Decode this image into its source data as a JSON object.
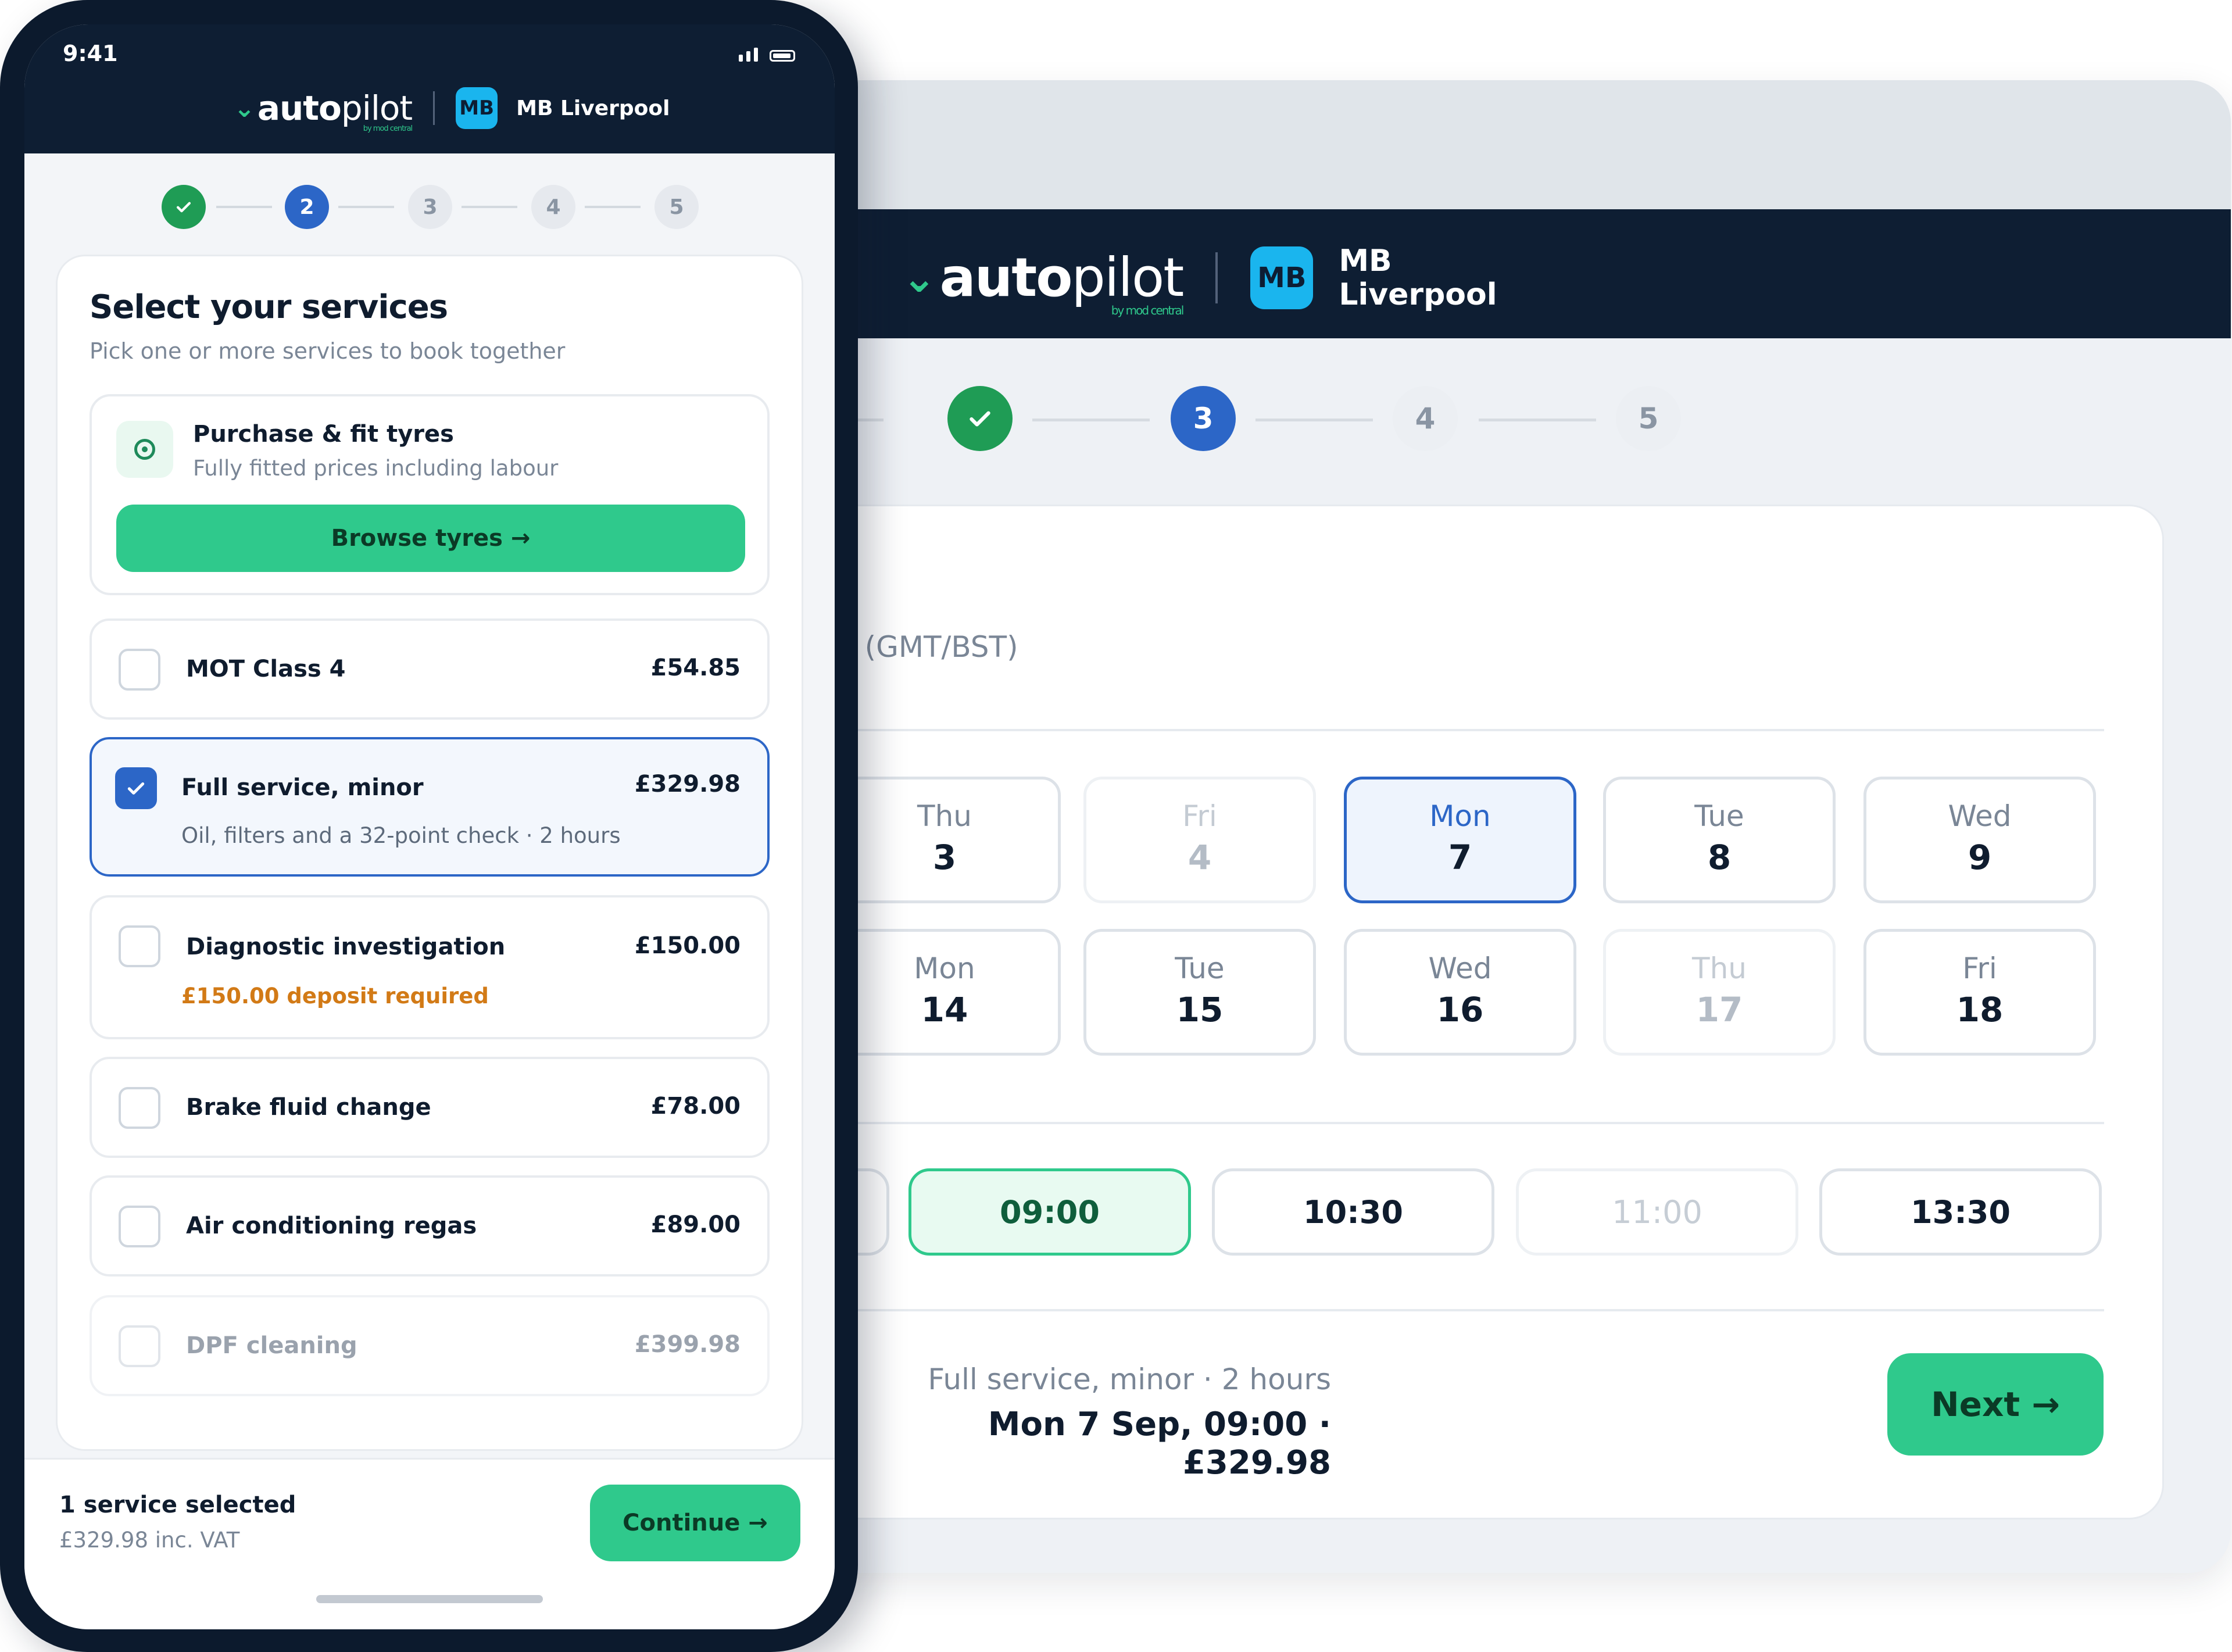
{
  "brand": {
    "logo_bold": "auto",
    "logo_light": "pilot",
    "logo_sub": "by mod central",
    "garage_badge": "MB",
    "garage_name": "MB Liverpool",
    "garage_line1": "MB",
    "garage_line2": "Liverpool"
  },
  "colors": {
    "navy": "#0e1e33",
    "accent_green": "#2fc98c",
    "accent_blue": "#2c66c7",
    "badge_cyan": "#1ab5ee",
    "deposit_orange": "#d27a16"
  },
  "desktop": {
    "steps": [
      {
        "label": "",
        "state": "done",
        "icon": "check-icon"
      },
      {
        "label": "3",
        "state": "active"
      },
      {
        "label": "4",
        "state": "upcoming"
      },
      {
        "label": "5",
        "state": "upcoming"
      }
    ],
    "timezone_note": "n (GMT/BST)",
    "days": [
      {
        "name": "Thu",
        "date": "3",
        "state": "available"
      },
      {
        "name": "Fri",
        "date": "4",
        "state": "unavailable"
      },
      {
        "name": "Mon",
        "date": "7",
        "state": "selected"
      },
      {
        "name": "Tue",
        "date": "8",
        "state": "available"
      },
      {
        "name": "Wed",
        "date": "9",
        "state": "available"
      },
      {
        "name": "Mon",
        "date": "14",
        "state": "available"
      },
      {
        "name": "Tue",
        "date": "15",
        "state": "available"
      },
      {
        "name": "Wed",
        "date": "16",
        "state": "available"
      },
      {
        "name": "Thu",
        "date": "17",
        "state": "unavailable"
      },
      {
        "name": "Fri",
        "date": "18",
        "state": "available"
      }
    ],
    "slots": [
      {
        "time": "",
        "state": "available"
      },
      {
        "time": "09:00",
        "state": "selected"
      },
      {
        "time": "10:30",
        "state": "available"
      },
      {
        "time": "11:00",
        "state": "unavailable"
      },
      {
        "time": "13:30",
        "state": "available"
      }
    ],
    "summary_line1": "Full service, minor · 2 hours",
    "summary_line2a": "Mon 7 Sep, 09:00 ·",
    "summary_line2b": "£329.98",
    "next_label": "Next →"
  },
  "phone": {
    "status_time": "9:41",
    "steps": [
      {
        "label": "",
        "state": "done",
        "icon": "check-icon"
      },
      {
        "label": "2",
        "state": "active"
      },
      {
        "label": "3",
        "state": "upcoming"
      },
      {
        "label": "4",
        "state": "upcoming"
      },
      {
        "label": "5",
        "state": "upcoming"
      }
    ],
    "title": "Select your services",
    "subtitle": "Pick one or more services to book together",
    "tyres": {
      "title": "Purchase & fit tyres",
      "subtitle": "Fully fitted prices including labour",
      "button": "Browse tyres →"
    },
    "services": [
      {
        "name": "MOT Class 4",
        "price": "£54.85",
        "checked": false
      },
      {
        "name": "Full service, minor",
        "price": "£329.98",
        "note": "Oil, filters and a 32-point check · 2 hours",
        "checked": true
      },
      {
        "name": "Diagnostic investigation",
        "price": "£150.00",
        "deposit": "£150.00 deposit required",
        "checked": false
      },
      {
        "name": "Brake fluid change",
        "price": "£78.00",
        "checked": false
      },
      {
        "name": "Air conditioning regas",
        "price": "£89.00",
        "checked": false
      },
      {
        "name": "DPF cleaning",
        "price": "£399.98",
        "checked": false
      }
    ],
    "footer": {
      "count": "1 service selected",
      "total": "£329.98 inc. VAT",
      "continue": "Continue →"
    }
  }
}
